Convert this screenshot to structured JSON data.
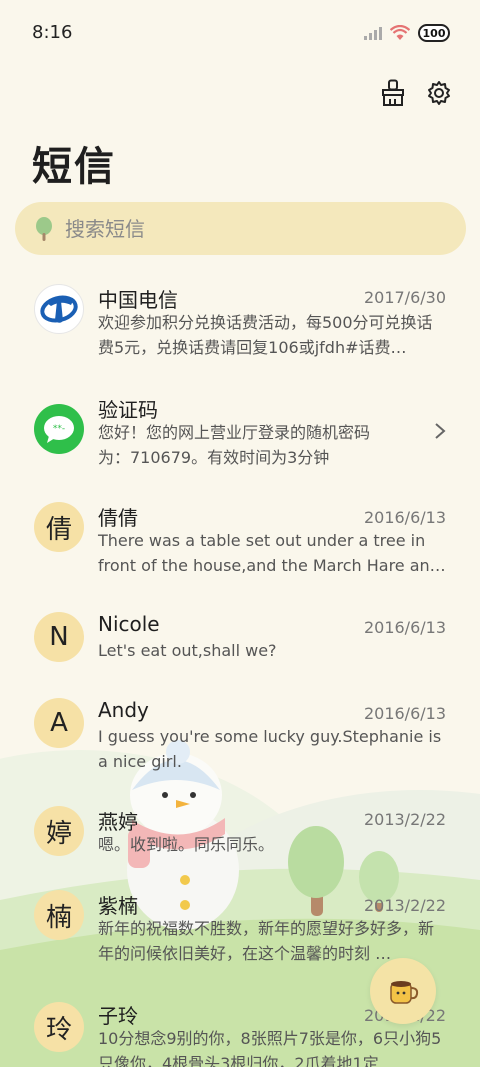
{
  "status_bar": {
    "time": "8:16",
    "battery": "100"
  },
  "header": {
    "title": "短信"
  },
  "search": {
    "placeholder": "搜索短信"
  },
  "messages": [
    {
      "name": "中国电信",
      "date": "2017/6/30",
      "preview": "欢迎参加积分兑换话费活动，每500分可兑换话费5元，兑换话费请回复106或jfdh#话费…",
      "avatar_type": "china-telecom-logo"
    },
    {
      "name": "验证码",
      "date": "",
      "preview": "您好！您的网上营业厅登录的随机密码为：710679。有效时间为3分钟",
      "avatar_type": "message-icon"
    },
    {
      "name": "倩倩",
      "date": "2016/6/13",
      "preview": "There was a table set out under a tree in front of the house,and the March Hare an…",
      "avatar_char": "倩"
    },
    {
      "name": "Nicole",
      "date": "2016/6/13",
      "preview": "Let's eat out,shall we?",
      "avatar_char": "N"
    },
    {
      "name": "Andy",
      "date": "2016/6/13",
      "preview": "I guess you're some lucky guy.Stephanie is a nice girl.",
      "avatar_char": "A"
    },
    {
      "name": "燕婷",
      "date": "2013/2/22",
      "preview": "嗯。收到啦。同乐同乐。",
      "avatar_char": "婷"
    },
    {
      "name": "紫楠",
      "date": "2013/2/22",
      "preview": "新年的祝福数不胜数，新年的愿望好多好多，新年的问候依旧美好，在这个温馨的时刻 …",
      "avatar_char": "楠"
    },
    {
      "name": "子玲",
      "date": "2013/2/22",
      "preview": "10分想念9别的你，8张照片7张是你，6只小狗5只像你，4根骨头3根归你，2爪着地1定…",
      "avatar_char": "玲"
    }
  ],
  "colors": {
    "background": "#faf7ec",
    "search_bg": "#f4e8bc",
    "avatar_bg": "#f6e1a6",
    "telecom_blue": "#1a5fb4",
    "message_green": "#2fbf4a"
  }
}
